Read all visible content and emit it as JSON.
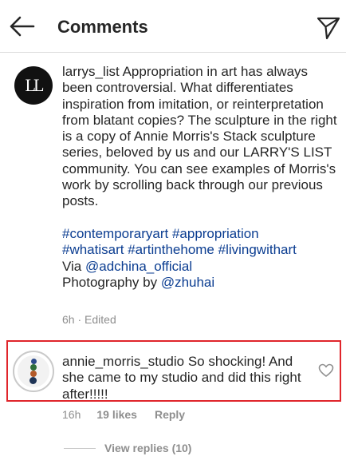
{
  "header": {
    "title": "Comments",
    "back_icon": "arrow-left-icon",
    "send_icon": "paper-plane-icon"
  },
  "caption": {
    "avatar_monogram": "LL",
    "username": "larrys_list",
    "text": "Appropriation in art has always been controversial. What differentiates inspiration from imitation, or reinterpretation from blatant copies? The sculpture in the right is a copy of Annie Morris's Stack sculpture series, beloved by us and our LARRY'S LIST community. You can see examples of Morris's work by scrolling back through our previous posts.",
    "hashtags_line1": "#contemporaryart #appropriation",
    "hashtags_line2": "#whatisart #artinthehome #livingwithart",
    "via_prefix": "Via ",
    "via_handle": "@adchina_official",
    "photo_prefix": "Photography by ",
    "photo_handle": "@zhuhai",
    "time": "6h",
    "separator": " · ",
    "edited": "Edited"
  },
  "reply": {
    "username": "annie_morris_studio",
    "text": "So shocking! And she came to my studio and did this right after!!!!!",
    "time": "16h",
    "likes": "19 likes",
    "reply_label": "Reply",
    "heart_icon": "heart-outline-icon",
    "highlight_color": "#e0252b"
  },
  "view_replies": "View replies (10)",
  "colors": {
    "text": "#262626",
    "muted": "#8e8e8e",
    "link": "#0b3d91"
  }
}
